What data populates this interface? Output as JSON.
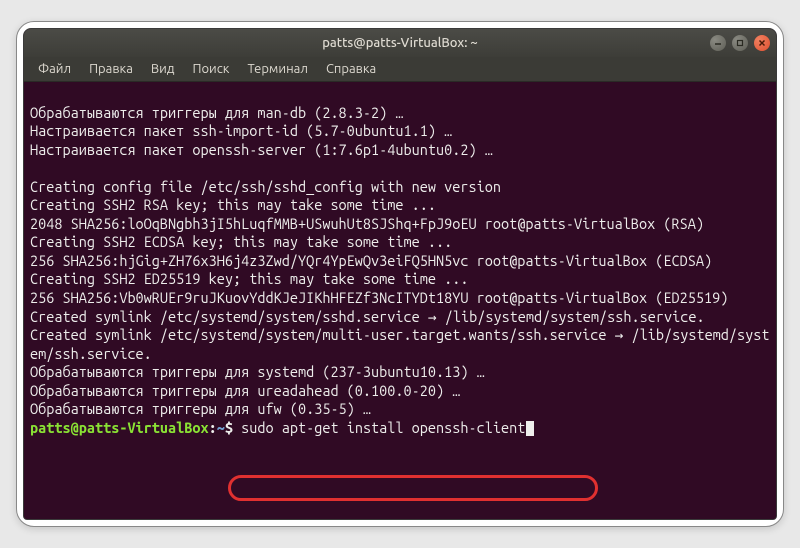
{
  "window": {
    "title": "patts@patts-VirtualBox: ~"
  },
  "menu": {
    "items": [
      "Файл",
      "Правка",
      "Вид",
      "Поиск",
      "Терминал",
      "Справка"
    ]
  },
  "terminal": {
    "lines": [
      "Обрабатываются триггеры для man-db (2.8.3-2) …",
      "Настраивается пакет ssh-import-id (5.7-0ubuntu1.1) …",
      "Настраивается пакет openssh-server (1:7.6p1-4ubuntu0.2) …",
      "",
      "Creating config file /etc/ssh/sshd_config with new version",
      "Creating SSH2 RSA key; this may take some time ...",
      "2048 SHA256:loOqBNgbh3jI5hLuqfMMB+USwuhUt8SJShq+FpJ9oEU root@patts-VirtualBox (RSA)",
      "Creating SSH2 ECDSA key; this may take some time ...",
      "256 SHA256:hjGig+ZH76x3H6j4z3Zwd/YQr4YpEwQv3eiFQ5HN5vc root@patts-VirtualBox (ECDSA)",
      "Creating SSH2 ED25519 key; this may take some time ...",
      "256 SHA256:Vb0wRUEr9ruJKuovYddKJeJIKhHFEZf3NcITYDt18YU root@patts-VirtualBox (ED25519)",
      "Created symlink /etc/systemd/system/sshd.service → /lib/systemd/system/ssh.service.",
      "Created symlink /etc/systemd/system/multi-user.target.wants/ssh.service → /lib/systemd/system/ssh.service.",
      "Обрабатываются триггеры для systemd (237-3ubuntu10.13) …",
      "Обрабатываются триггеры для ureadahead (0.100.0-20) …",
      "Обрабатываются триггеры для ufw (0.35-5) …"
    ],
    "prompt": {
      "user_host": "patts@patts-VirtualBox",
      "colon": ":",
      "path": "~",
      "dollar": "$ ",
      "command": "sudo apt-get install openssh-client"
    }
  }
}
